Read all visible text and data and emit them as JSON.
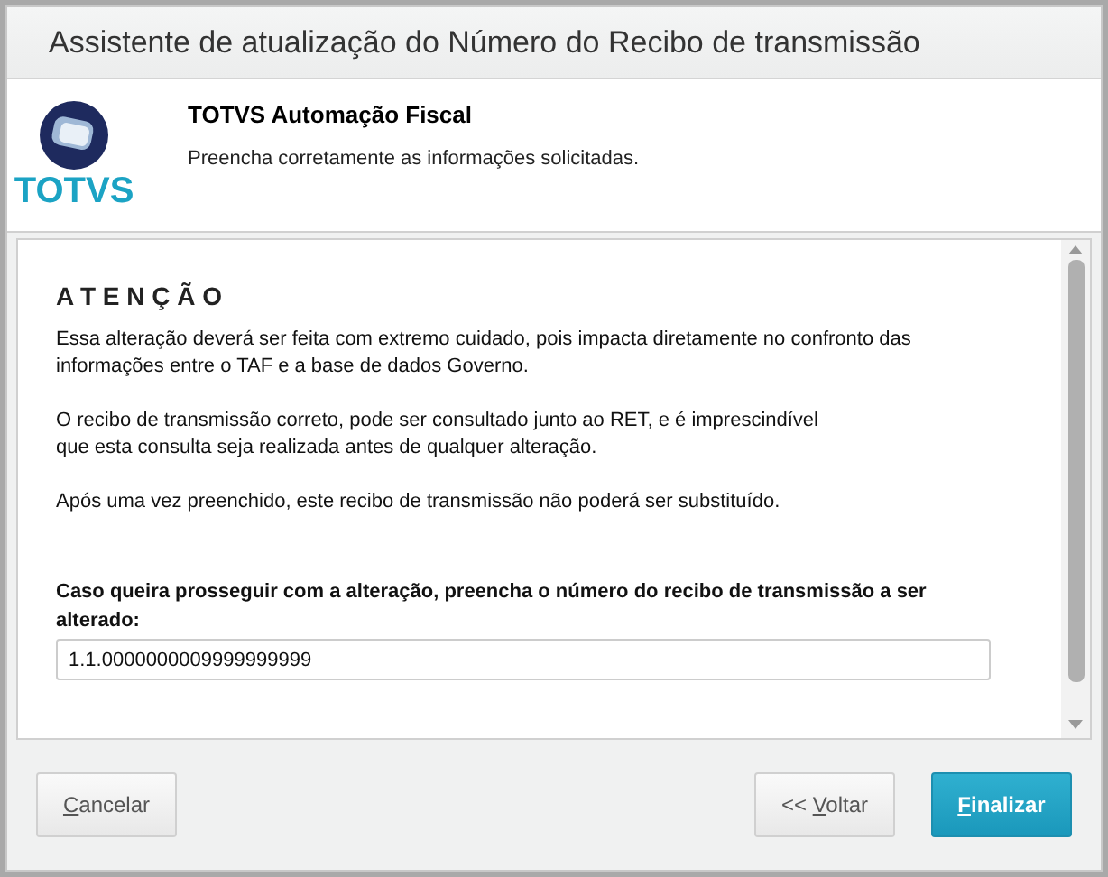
{
  "window": {
    "title": "Assistente de atualização do Número do Recibo de transmissão"
  },
  "header": {
    "logo_text": "TOTVS",
    "title": "TOTVS Automação Fiscal",
    "subtitle": "Preencha corretamente as informações solicitadas."
  },
  "content": {
    "heading": "A T E N Ç Ã O",
    "paragraphs": [
      [
        "Essa alteração deverá ser feita com extremo cuidado, pois impacta diretamente no confronto das",
        "informações entre o TAF e a base de dados Governo."
      ],
      [
        "O recibo de transmissão correto, pode ser consultado junto ao RET, e é imprescindível",
        "que esta consulta seja realizada antes de qualquer alteração."
      ],
      [
        "Após uma vez preenchido, este recibo de transmissão não poderá ser substituído."
      ]
    ],
    "field_label": "Caso queira prosseguir com a alteração, preencha o número do recibo de transmissão a ser alterado:",
    "field_value": "1.1.0000000009999999999"
  },
  "buttons": [
    {
      "kind": "secondary",
      "key": "C",
      "rest": "ancelar"
    },
    {
      "kind": "secondary",
      "prefix": "<< ",
      "key": "V",
      "rest": "oltar"
    },
    {
      "kind": "primary",
      "key": "F",
      "rest": "inalizar"
    }
  ]
}
